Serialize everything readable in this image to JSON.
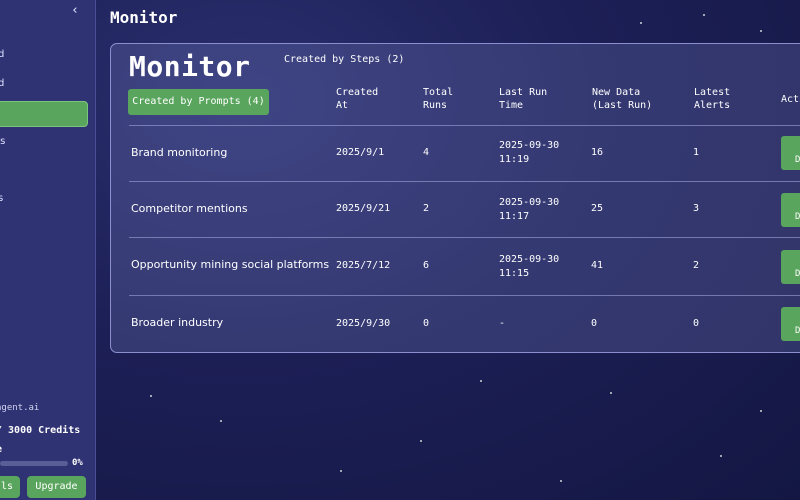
{
  "sidebar": {
    "collapse_icon": "‹",
    "items": [
      {
        "label": "d"
      },
      {
        "label": "d"
      },
      {
        "label": ""
      },
      {
        "label": "es"
      },
      {
        "label": "s"
      }
    ],
    "domain": "agent.ai",
    "credits": "/ 3000 Credits",
    "plan": "e",
    "usage_percent": "0%",
    "usage_value": 0,
    "left_button": "ls",
    "upgrade_button": "Upgrade"
  },
  "page": {
    "title": "Monitor"
  },
  "monitor": {
    "title": "Monitor",
    "tab_steps": "Created by Steps (2)",
    "tab_prompts": "Created by Prompts (4)",
    "columns": {
      "created_at": [
        "Created",
        "At"
      ],
      "total_runs": [
        "Total",
        "Runs"
      ],
      "last_run": [
        "Last Run",
        "Time"
      ],
      "new_data": [
        "New Data",
        "(Last Run)"
      ],
      "latest_alerts": [
        "Latest",
        "Alerts"
      ],
      "actions": "Acti"
    },
    "rows": [
      {
        "name": "Brand monitoring",
        "created": "2025/9/1",
        "runs": "4",
        "last_run_date": "2025-09-30",
        "last_run_time": "11:19",
        "new_data": "16",
        "alerts": "1",
        "action": "D"
      },
      {
        "name": "Competitor mentions",
        "created": "2025/9/21",
        "runs": "2",
        "last_run_date": "2025-09-30",
        "last_run_time": "11:17",
        "new_data": "25",
        "alerts": "3",
        "action": "D"
      },
      {
        "name": "Opportunity mining social platforms",
        "created": "2025/7/12",
        "runs": "6",
        "last_run_date": "2025-09-30",
        "last_run_time": "11:15",
        "new_data": "41",
        "alerts": "2",
        "action": "D"
      },
      {
        "name": "Broader industry",
        "created": "2025/9/30",
        "runs": "0",
        "last_run_date": "-",
        "last_run_time": "",
        "new_data": "0",
        "alerts": "0",
        "action": "D"
      }
    ]
  },
  "colors": {
    "accent_green": "#5aa55d",
    "sidebar_bg": "#2f3373",
    "page_bg": "#1c1f55",
    "card_border": "#8b8fd0"
  }
}
